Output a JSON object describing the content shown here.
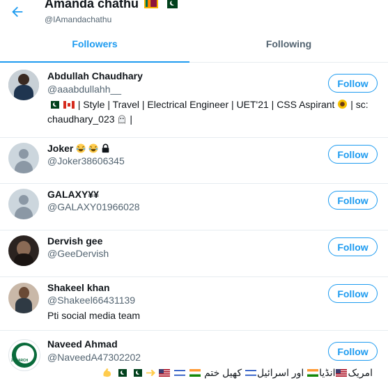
{
  "header": {
    "title": "Amanda chathu",
    "handle": "@IAmandachathu"
  },
  "tabs": [
    {
      "label": "Followers"
    },
    {
      "label": "Following"
    }
  ],
  "colors": {
    "accent": "#1d9bf0",
    "muted": "#536471",
    "divider": "#e6ecf0"
  },
  "followers": [
    {
      "name": "Abdullah Chaudhary",
      "handle": "@aaabdullahh__",
      "bio_text": "| Style | Travel | Electrical Engineer | UET'21 | CSS Aspirant",
      "bio_tail": "| sc:",
      "bio_line2": "chaudhary_023",
      "bio_end": "|",
      "button": "Follow"
    },
    {
      "name": "Joker",
      "handle": "@Joker38606345",
      "button": "Follow"
    },
    {
      "name": "GALAXY¥¥",
      "handle": "@GALAXY01966028",
      "button": "Follow"
    },
    {
      "name": "Dervish gee",
      "handle": "@GeeDervish",
      "button": "Follow"
    },
    {
      "name": "Shakeel khan",
      "handle": "@Shakeel66431139",
      "bio": "Pti social media team",
      "button": "Follow"
    },
    {
      "name": "Naveed Ahmad",
      "handle": "@NaveedA47302202",
      "bio_urdu_1": "امریک",
      "bio_urdu_2": "انڈیا",
      "bio_urdu_3": "اور اسرائیل",
      "bio_urdu_4": "کھیل ختم",
      "button": "Follow",
      "avatar_badge": "23MARCH"
    }
  ]
}
